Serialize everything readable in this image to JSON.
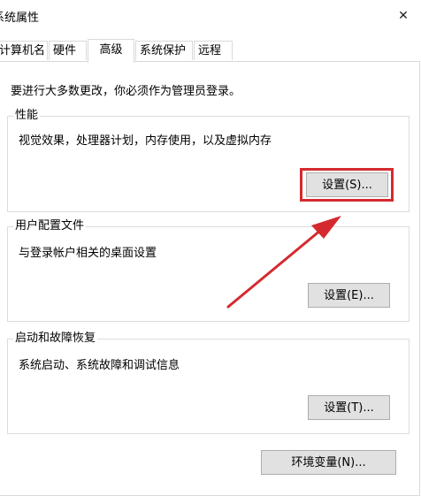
{
  "window": {
    "title": "系统属性",
    "close_glyph": "✕"
  },
  "tabs": [
    {
      "label": "计算机名",
      "active": false
    },
    {
      "label": "硬件",
      "active": false
    },
    {
      "label": "高级",
      "active": true
    },
    {
      "label": "系统保护",
      "active": false
    },
    {
      "label": "远程",
      "active": false
    }
  ],
  "advanced": {
    "admin_note": "要进行大多数更改，你必须作为管理员登录。",
    "performance": {
      "title": "性能",
      "description": "视觉效果，处理器计划，内存使用，以及虚拟内存",
      "button_label": "设置(S)..."
    },
    "user_profiles": {
      "title": "用户配置文件",
      "description": "与登录帐户相关的桌面设置",
      "button_label": "设置(E)..."
    },
    "startup_recovery": {
      "title": "启动和故障恢复",
      "description": "系统启动、系统故障和调试信息",
      "button_label": "设置(T)..."
    },
    "env_button_label": "环境变量(N)..."
  },
  "annotation": {
    "highlight_color": "#d42a2f",
    "arrow_color": "#d42a2f"
  }
}
